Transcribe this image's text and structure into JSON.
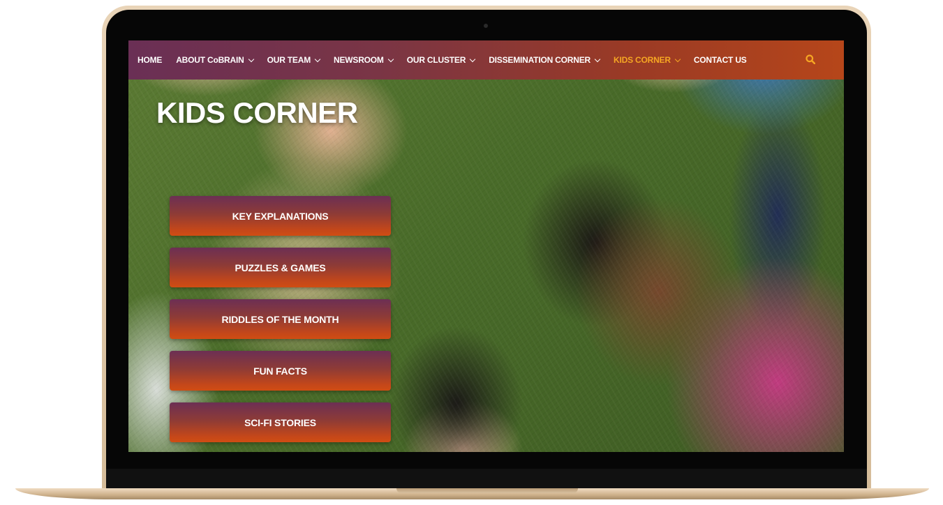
{
  "nav": {
    "items": [
      {
        "label": "HOME",
        "has_dropdown": false
      },
      {
        "label": "ABOUT CoBRAIN",
        "has_dropdown": true
      },
      {
        "label": "OUR TEAM",
        "has_dropdown": true
      },
      {
        "label": "NEWSROOM",
        "has_dropdown": true
      },
      {
        "label": "OUR CLUSTER",
        "has_dropdown": true
      },
      {
        "label": "DISSEMINATION CORNER",
        "has_dropdown": true
      },
      {
        "label": "KIDS CORNER",
        "has_dropdown": true,
        "active": true
      },
      {
        "label": "CONTACT US",
        "has_dropdown": false
      }
    ],
    "search_icon": "search-icon",
    "active_color": "#f5a623"
  },
  "hero": {
    "title": "KIDS CORNER"
  },
  "menu": {
    "buttons": [
      "KEY EXPLANATIONS",
      "PUZZLES & GAMES",
      "RIDDLES OF THE MONTH",
      "FUN FACTS",
      "SCI-FI STORIES"
    ]
  },
  "colors": {
    "nav_gradient_start": "#6a2f55",
    "nav_gradient_end": "#b6461a",
    "button_gradient_top": "#6c2f54",
    "button_gradient_bottom": "#d04d13"
  }
}
